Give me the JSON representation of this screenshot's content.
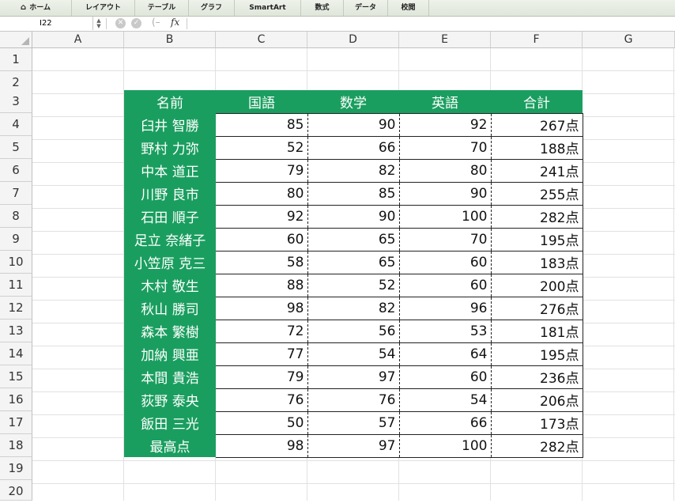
{
  "ribbon": {
    "tabs": [
      {
        "label": "ホーム",
        "icon": "home-icon"
      },
      {
        "label": "レイアウト"
      },
      {
        "label": "テーブル"
      },
      {
        "label": "グラフ"
      },
      {
        "label": "SmartArt"
      },
      {
        "label": "数式"
      },
      {
        "label": "データ"
      },
      {
        "label": "校閲"
      }
    ]
  },
  "formula_bar": {
    "name_box": "I22",
    "fx_label": "fx",
    "content": ""
  },
  "columns": [
    "A",
    "B",
    "C",
    "D",
    "E",
    "F",
    "G"
  ],
  "rows": [
    "1",
    "2",
    "3",
    "4",
    "5",
    "6",
    "7",
    "8",
    "9",
    "10",
    "11",
    "12",
    "13",
    "14",
    "15",
    "16",
    "17",
    "18",
    "19",
    "20"
  ],
  "table": {
    "headers": [
      "名前",
      "国語",
      "数学",
      "英語",
      "合計"
    ],
    "rows": [
      [
        "臼井 智勝",
        "85",
        "90",
        "92",
        "267点"
      ],
      [
        "野村 力弥",
        "52",
        "66",
        "70",
        "188点"
      ],
      [
        "中本 道正",
        "79",
        "82",
        "80",
        "241点"
      ],
      [
        "川野 良市",
        "80",
        "85",
        "90",
        "255点"
      ],
      [
        "石田 順子",
        "92",
        "90",
        "100",
        "282点"
      ],
      [
        "足立 奈緒子",
        "60",
        "65",
        "70",
        "195点"
      ],
      [
        "小笠原 克三",
        "58",
        "65",
        "60",
        "183点"
      ],
      [
        "木村 敬生",
        "88",
        "52",
        "60",
        "200点"
      ],
      [
        "秋山 勝司",
        "98",
        "82",
        "96",
        "276点"
      ],
      [
        "森本 繁樹",
        "72",
        "56",
        "53",
        "181点"
      ],
      [
        "加納 興亜",
        "77",
        "54",
        "64",
        "195点"
      ],
      [
        "本間 貴浩",
        "79",
        "97",
        "60",
        "236点"
      ],
      [
        "荻野 泰央",
        "76",
        "76",
        "54",
        "206点"
      ],
      [
        "飯田 三光",
        "50",
        "57",
        "66",
        "173点"
      ]
    ],
    "summary": [
      "最高点",
      "98",
      "97",
      "100",
      "282点"
    ]
  },
  "colors": {
    "header_green": "#1a9e5f"
  }
}
